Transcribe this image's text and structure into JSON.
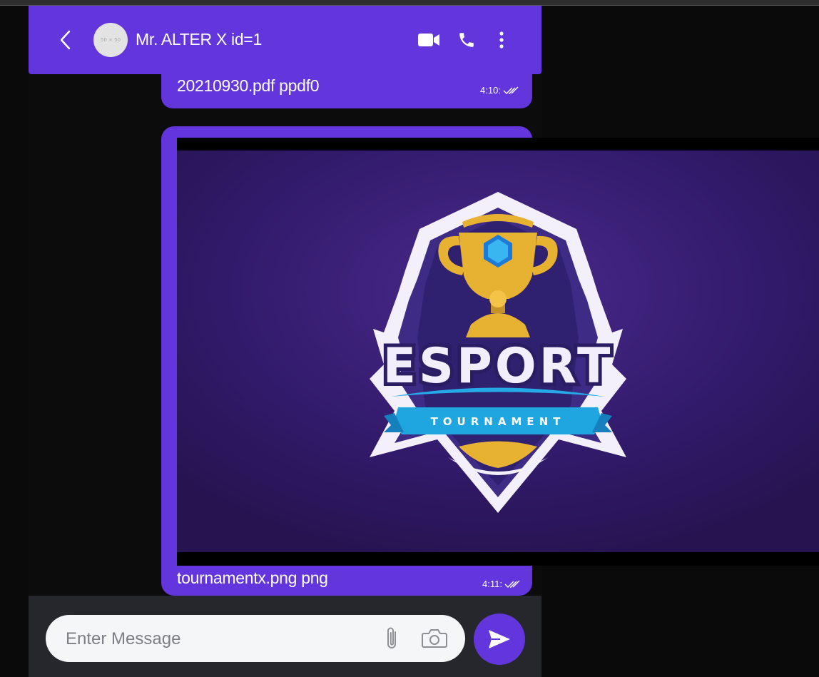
{
  "header": {
    "avatar_placeholder": "50 × 50",
    "contact_name": "Mr. ALTER X id=1"
  },
  "messages": [
    {
      "text": "20210930.pdf ppdf0",
      "time": "4:10:",
      "status_icon": "double-check-icon"
    },
    {
      "caption": "tournamentx.png png",
      "time": "4:11:",
      "status_icon": "double-check-icon",
      "image": {
        "title": "ESPORT",
        "ribbon": "TOURNAMENT"
      }
    }
  ],
  "composer": {
    "placeholder": "Enter Message"
  },
  "colors": {
    "accent": "#6236dc",
    "background": "#0c0c0c",
    "composer_bar": "#25272c",
    "image_bg": "#3a1f78",
    "gold": "#e7b232",
    "ribbon_blue": "#1fa5e0"
  },
  "icons": [
    "back-icon",
    "video-call-icon",
    "phone-icon",
    "more-icon",
    "attach-icon",
    "camera-icon",
    "send-icon"
  ]
}
